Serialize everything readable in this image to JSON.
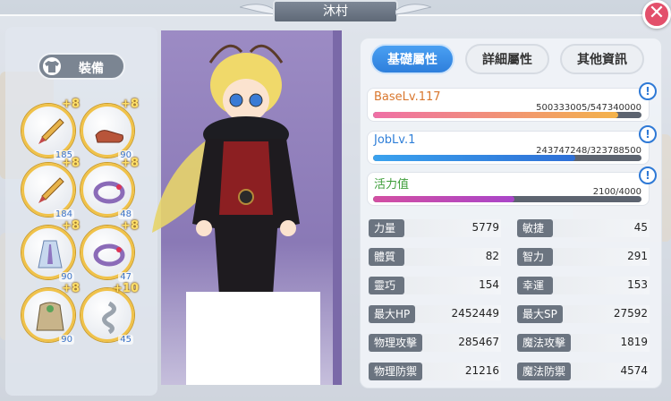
{
  "window": {
    "title": "沐村",
    "close_glyph": "✕"
  },
  "equipment": {
    "tab_label": "裝備",
    "slots": [
      {
        "icon": "dagger-icon",
        "refine": "+8",
        "level": "185"
      },
      {
        "icon": "shoes-icon",
        "refine": "+8",
        "level": "90"
      },
      {
        "icon": "dagger-icon",
        "refine": "+8",
        "level": "184"
      },
      {
        "icon": "ring-icon",
        "refine": "+8",
        "level": "48"
      },
      {
        "icon": "robe-icon",
        "refine": "+8",
        "level": "90"
      },
      {
        "icon": "ring-icon",
        "refine": "+8",
        "level": "47"
      },
      {
        "icon": "cloak-icon",
        "refine": "+8",
        "level": "90"
      },
      {
        "icon": "snake-charm-icon",
        "refine": "+10",
        "level": "45"
      }
    ]
  },
  "tabs": [
    {
      "label": "基礎屬性",
      "active": true
    },
    {
      "label": "詳細屬性",
      "active": false
    },
    {
      "label": "其他資訊",
      "active": false
    }
  ],
  "bars": [
    {
      "label": "BaseLv.117",
      "value_text": "500333005/547340000",
      "fraction": 0.914,
      "color": "#d9772e",
      "fill": "linear-gradient(90deg,#ef6fa6,#f3b34a)"
    },
    {
      "label": "JobLv.1",
      "value_text": "243747248/323788500",
      "fraction": 0.753,
      "color": "#2f7fd8",
      "fill": "linear-gradient(90deg,#3aa2ee,#2e6fd6)"
    },
    {
      "label": "活力值",
      "value_text": "2100/4000",
      "fraction": 0.525,
      "color": "#3e9e3a",
      "fill": "linear-gradient(90deg,#d34fa2,#a945c9)"
    }
  ],
  "info_glyph": "!",
  "stats": [
    {
      "label": "力量",
      "value": "5779"
    },
    {
      "label": "敏捷",
      "value": "45"
    },
    {
      "label": "體質",
      "value": "82"
    },
    {
      "label": "智力",
      "value": "291"
    },
    {
      "label": "靈巧",
      "value": "154"
    },
    {
      "label": "幸運",
      "value": "153"
    },
    {
      "label": "最大HP",
      "value": "2452449"
    },
    {
      "label": "最大SP",
      "value": "27592"
    },
    {
      "label": "物理攻擊",
      "value": "285467"
    },
    {
      "label": "魔法攻擊",
      "value": "1819"
    },
    {
      "label": "物理防禦",
      "value": "21216"
    },
    {
      "label": "魔法防禦",
      "value": "4574"
    }
  ]
}
